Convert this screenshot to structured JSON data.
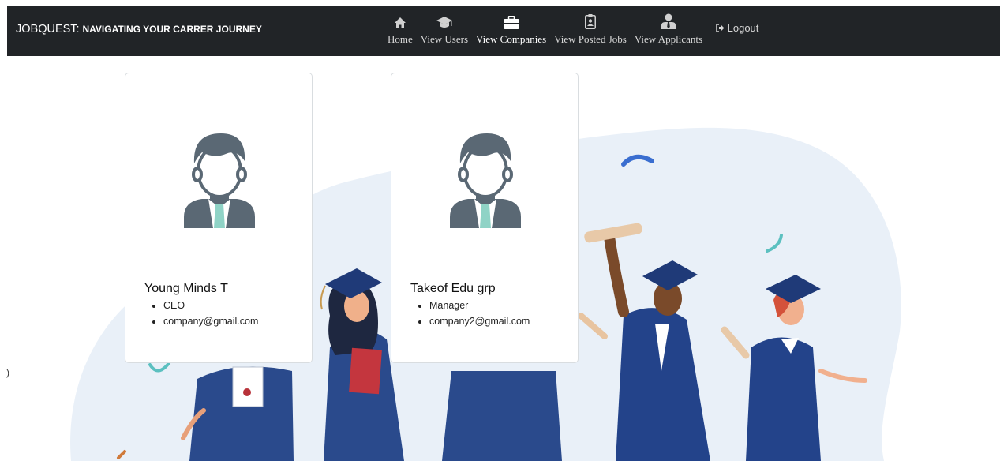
{
  "navbar": {
    "brand_main": "JOBQUEST:",
    "brand_sub": "NAVIGATING YOUR CARRER JOURNEY",
    "items": [
      {
        "label": "Home",
        "icon": "home-icon"
      },
      {
        "label": "View Users",
        "icon": "graduation-cap-icon"
      },
      {
        "label": "View Companies",
        "icon": "briefcase-icon",
        "active": true
      },
      {
        "label": "View Posted Jobs",
        "icon": "id-badge-icon"
      },
      {
        "label": "View Applicants",
        "icon": "user-tie-icon"
      }
    ],
    "logout_label": "Logout"
  },
  "companies": [
    {
      "name": "Young Minds T",
      "role": "CEO",
      "email": "company@gmail.com"
    },
    {
      "name": "Takeof Edu grp",
      "role": "Manager",
      "email": "company2@gmail.com"
    }
  ],
  "stray_text": ")",
  "colors": {
    "navbar_bg": "#212427",
    "gown": "#2a4a8c",
    "hero_bg": "#e8f0f8",
    "avatar": "#5a6874",
    "tie": "#8fd3c6"
  }
}
